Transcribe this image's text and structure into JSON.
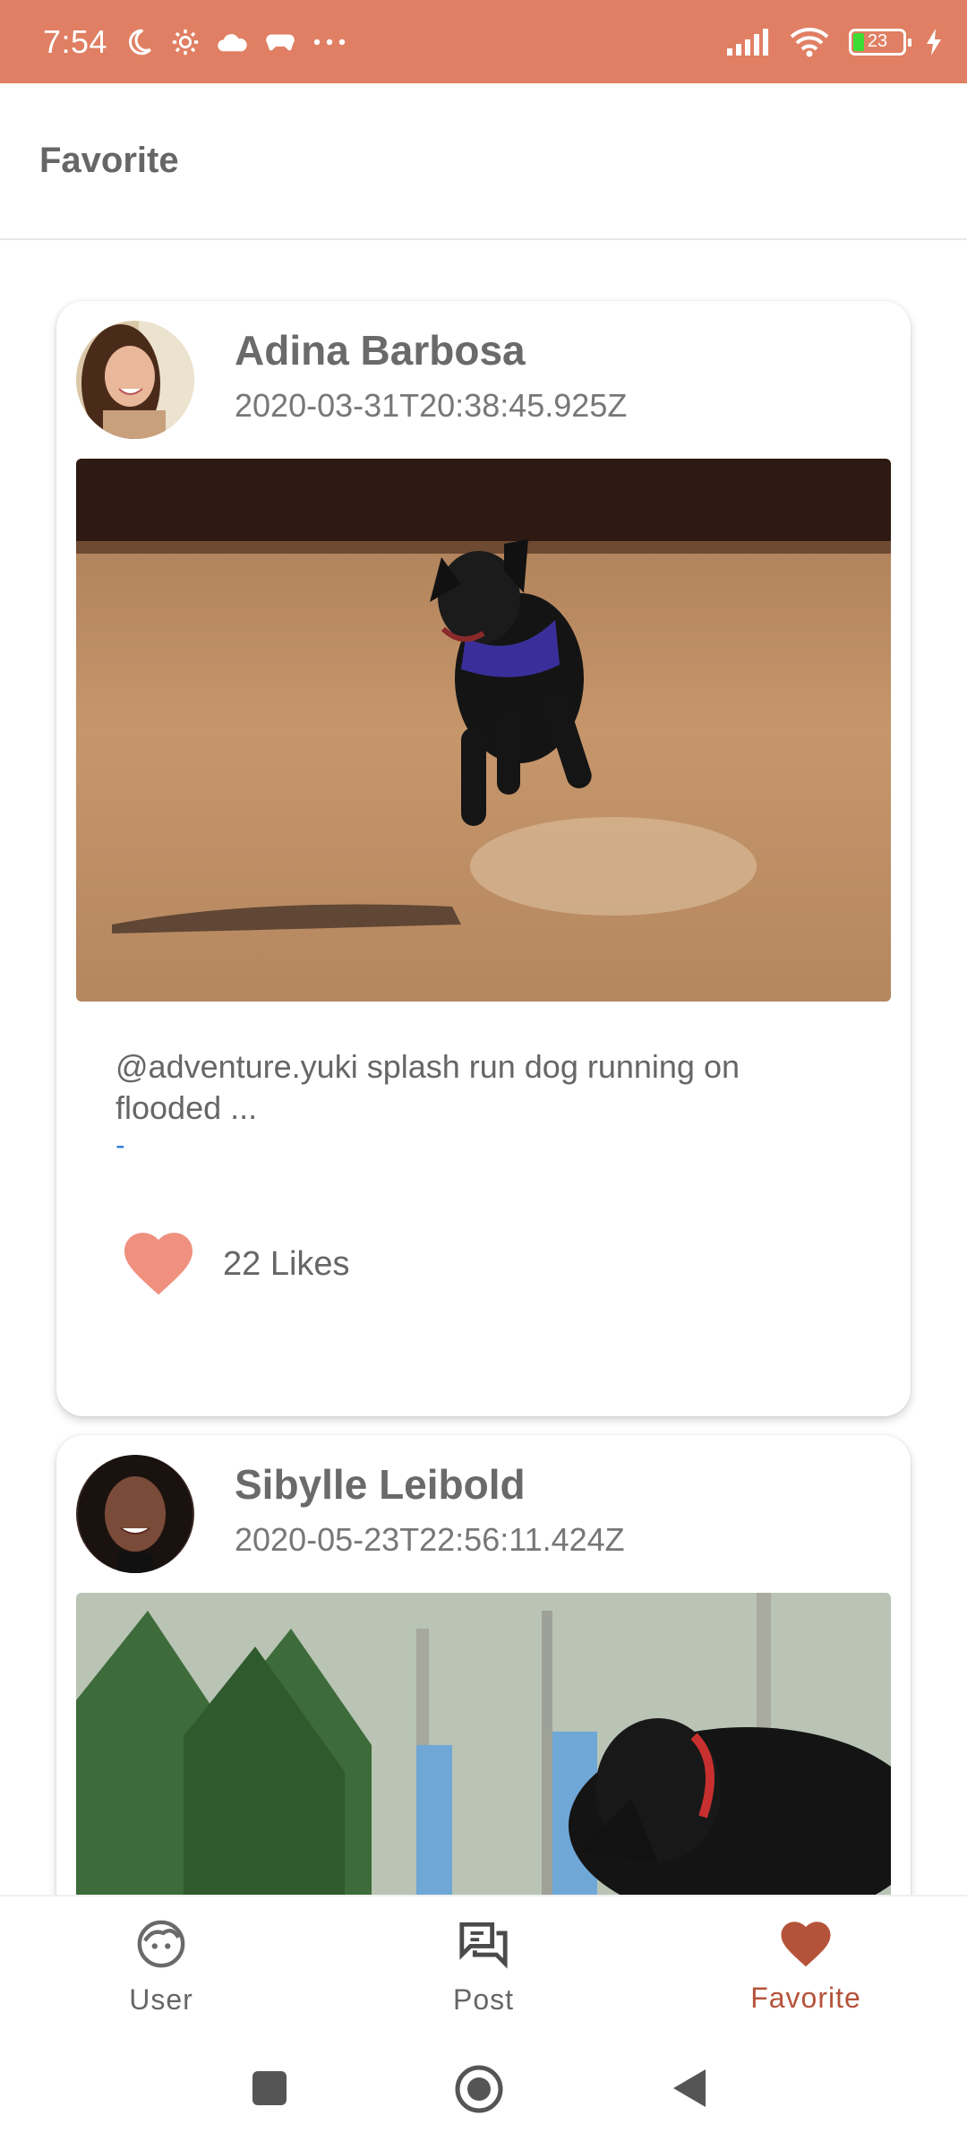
{
  "status_bar": {
    "time": "7:54",
    "battery_level": "23",
    "icons": [
      "moon-icon",
      "settings-icon",
      "cloud-icon",
      "game-icon",
      "more-dots-icon",
      "signal-icon",
      "wifi-icon",
      "battery-icon",
      "charging-icon"
    ],
    "bar_color": "#E07F63"
  },
  "app_bar": {
    "title": "Favorite"
  },
  "posts": [
    {
      "user_name": "Adina Barbosa",
      "date": "2020-03-31T20:38:45.925Z",
      "text": "@adventure.yuki splash run dog running on flooded ...",
      "link": "-",
      "likes": "22 Likes"
    },
    {
      "user_name": "Sibylle Leibold",
      "date": "2020-05-23T22:56:11.424Z"
    }
  ],
  "bottom_nav": {
    "items": [
      {
        "label": "User",
        "icon": "user-face-icon"
      },
      {
        "label": "Post",
        "icon": "chat-bubbles-icon"
      },
      {
        "label": "Favorite",
        "icon": "heart-icon"
      }
    ],
    "active": "Favorite",
    "accent_color": "#B5533A"
  }
}
